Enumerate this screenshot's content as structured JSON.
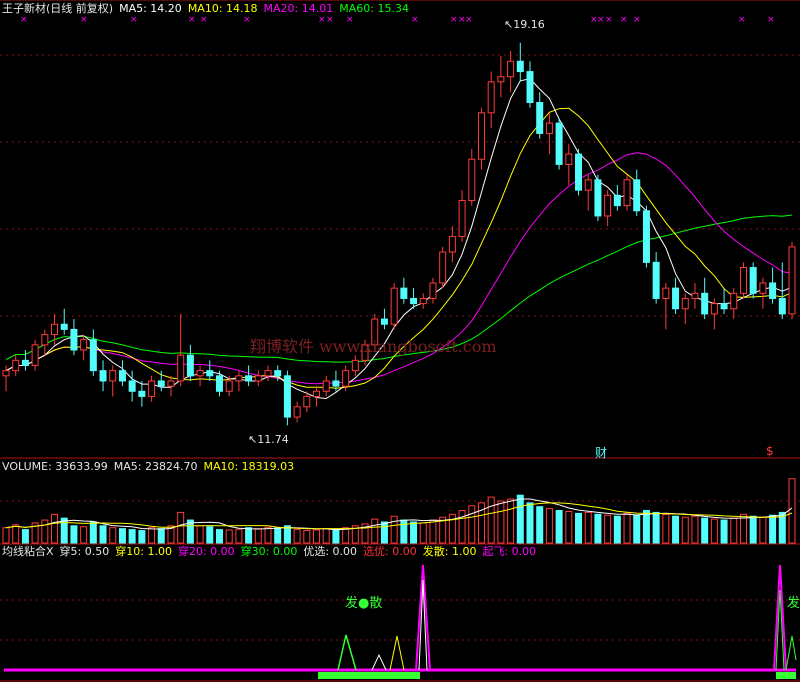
{
  "headers": {
    "main": [
      {
        "text": "王子新材(日线 前复权)",
        "color": "#e6e6e6"
      },
      {
        "text": "MA5: 14.20",
        "color": "#ffffff"
      },
      {
        "text": "MA10: 14.18",
        "color": "#ffff00"
      },
      {
        "text": "MA20: 14.01",
        "color": "#ff00ff"
      },
      {
        "text": "MA60: 15.34",
        "color": "#00ff00"
      }
    ],
    "volume": [
      {
        "text": "VOLUME: 33633.99",
        "color": "#e6e6e6"
      },
      {
        "text": "MA5: 23824.70",
        "color": "#e6e6e6"
      },
      {
        "text": "MA10: 18319.03",
        "color": "#ffff00"
      }
    ],
    "indicator": [
      {
        "text": "均线粘合X",
        "color": "#e6e6e6"
      },
      {
        "text": "穿5: 0.50",
        "color": "#e6e6e6"
      },
      {
        "text": "穿10: 1.00",
        "color": "#ffff00"
      },
      {
        "text": "穿20: 0.00",
        "color": "#ff00ff"
      },
      {
        "text": "穿30: 0.00",
        "color": "#00ff00"
      },
      {
        "text": "优选: 0.00",
        "color": "#e6e6e6"
      },
      {
        "text": "选优: 0.00",
        "color": "#ff3030"
      },
      {
        "text": "发散: 1.00",
        "color": "#ffff00"
      },
      {
        "text": "起飞: 0.00",
        "color": "#ff00ff"
      }
    ]
  },
  "watermark": "翔博软件 www.xiangbosoft.com",
  "annotations": {
    "high": "19.16",
    "low": "11.74",
    "fa_san": "发●散",
    "fa": "发",
    "cai": "财",
    "dollar": "$"
  },
  "colors": {
    "up": "#ff3a3a",
    "down": "#54fcfc",
    "ma5": "#ffffff",
    "ma10": "#ffff00",
    "ma20": "#ff00ff",
    "ma60": "#00ff00",
    "grid": "#8a1010"
  },
  "chart_data": [
    {
      "type": "candlestick",
      "series": [
        {
          "name": "MA5",
          "value": 14.2
        },
        {
          "name": "MA10",
          "value": 14.18
        },
        {
          "name": "MA20",
          "value": 14.01
        },
        {
          "name": "MA60",
          "value": 15.34
        }
      ],
      "ohlc": [
        [
          12.7,
          12.9,
          12.4,
          12.8
        ],
        [
          12.8,
          13.1,
          12.7,
          13.0
        ],
        [
          13.0,
          13.2,
          12.8,
          12.9
        ],
        [
          12.9,
          13.4,
          12.8,
          13.3
        ],
        [
          13.3,
          13.6,
          13.1,
          13.5
        ],
        [
          13.5,
          13.9,
          13.3,
          13.7
        ],
        [
          13.7,
          14.0,
          13.5,
          13.6
        ],
        [
          13.6,
          13.8,
          13.1,
          13.2
        ],
        [
          13.2,
          13.5,
          13.0,
          13.4
        ],
        [
          13.4,
          13.6,
          12.7,
          12.8
        ],
        [
          12.8,
          13.0,
          12.4,
          12.6
        ],
        [
          12.6,
          12.9,
          12.3,
          12.8
        ],
        [
          12.8,
          13.0,
          12.5,
          12.6
        ],
        [
          12.6,
          12.8,
          12.2,
          12.4
        ],
        [
          12.4,
          12.6,
          12.1,
          12.3
        ],
        [
          12.3,
          12.7,
          12.2,
          12.6
        ],
        [
          12.6,
          12.8,
          12.4,
          12.5
        ],
        [
          12.5,
          12.7,
          12.3,
          12.6
        ],
        [
          12.6,
          13.9,
          12.5,
          13.1
        ],
        [
          13.1,
          13.3,
          12.6,
          12.7
        ],
        [
          12.7,
          12.9,
          12.5,
          12.8
        ],
        [
          12.8,
          13.0,
          12.6,
          12.7
        ],
        [
          12.7,
          12.8,
          12.3,
          12.4
        ],
        [
          12.4,
          12.7,
          12.3,
          12.6
        ],
        [
          12.6,
          12.8,
          12.4,
          12.7
        ],
        [
          12.7,
          12.9,
          12.5,
          12.6
        ],
        [
          12.6,
          12.8,
          12.5,
          12.7
        ],
        [
          12.7,
          12.9,
          12.6,
          12.8
        ],
        [
          12.8,
          12.9,
          12.6,
          12.7
        ],
        [
          12.7,
          12.8,
          11.74,
          11.9
        ],
        [
          11.9,
          12.2,
          11.8,
          12.1
        ],
        [
          12.1,
          12.4,
          12.0,
          12.3
        ],
        [
          12.3,
          12.5,
          12.1,
          12.4
        ],
        [
          12.4,
          12.7,
          12.3,
          12.6
        ],
        [
          12.6,
          12.8,
          12.4,
          12.5
        ],
        [
          12.5,
          12.9,
          12.4,
          12.8
        ],
        [
          12.8,
          13.1,
          12.7,
          13.0
        ],
        [
          13.0,
          13.4,
          12.9,
          13.3
        ],
        [
          13.3,
          13.9,
          13.2,
          13.8
        ],
        [
          13.8,
          14.0,
          13.6,
          13.7
        ],
        [
          13.7,
          14.5,
          13.6,
          14.4
        ],
        [
          14.4,
          14.6,
          14.1,
          14.2
        ],
        [
          14.2,
          14.4,
          14.0,
          14.1
        ],
        [
          14.1,
          14.3,
          14.0,
          14.2
        ],
        [
          14.2,
          14.6,
          14.1,
          14.5
        ],
        [
          14.5,
          15.2,
          14.4,
          15.1
        ],
        [
          15.1,
          15.6,
          14.9,
          15.4
        ],
        [
          15.4,
          16.3,
          15.3,
          16.1
        ],
        [
          16.1,
          17.1,
          16.0,
          16.9
        ],
        [
          16.9,
          17.9,
          16.7,
          17.8
        ],
        [
          17.8,
          18.6,
          17.5,
          18.4
        ],
        [
          18.4,
          18.9,
          18.1,
          18.5
        ],
        [
          18.5,
          19.0,
          18.2,
          18.8
        ],
        [
          18.8,
          19.16,
          18.4,
          18.6
        ],
        [
          18.6,
          18.8,
          17.9,
          18.0
        ],
        [
          18.0,
          18.2,
          17.3,
          17.4
        ],
        [
          17.4,
          17.8,
          17.0,
          17.6
        ],
        [
          17.6,
          17.7,
          16.7,
          16.8
        ],
        [
          16.8,
          17.2,
          16.4,
          17.0
        ],
        [
          17.0,
          17.1,
          16.2,
          16.3
        ],
        [
          16.3,
          16.6,
          15.9,
          16.5
        ],
        [
          16.5,
          16.6,
          15.7,
          15.8
        ],
        [
          15.8,
          16.3,
          15.6,
          16.2
        ],
        [
          16.2,
          16.4,
          15.9,
          16.0
        ],
        [
          16.0,
          16.6,
          15.9,
          16.5
        ],
        [
          16.5,
          16.7,
          15.8,
          15.9
        ],
        [
          15.9,
          16.0,
          14.8,
          14.9
        ],
        [
          14.9,
          15.1,
          14.1,
          14.2
        ],
        [
          14.2,
          14.5,
          13.6,
          14.4
        ],
        [
          14.4,
          14.6,
          13.9,
          14.0
        ],
        [
          14.0,
          14.3,
          13.7,
          14.2
        ],
        [
          14.2,
          14.5,
          14.0,
          14.3
        ],
        [
          14.3,
          14.6,
          13.8,
          13.9
        ],
        [
          13.9,
          14.2,
          13.6,
          14.1
        ],
        [
          14.1,
          14.4,
          13.9,
          14.0
        ],
        [
          14.0,
          14.4,
          13.8,
          14.3
        ],
        [
          14.3,
          14.9,
          14.2,
          14.8
        ],
        [
          14.8,
          14.9,
          14.2,
          14.3
        ],
        [
          14.3,
          14.6,
          14.0,
          14.5
        ],
        [
          14.5,
          14.8,
          14.1,
          14.2
        ],
        [
          14.2,
          14.9,
          13.8,
          13.9
        ],
        [
          13.9,
          15.3,
          13.8,
          15.2
        ]
      ],
      "low_label": 11.74,
      "high_label": 19.16
    },
    {
      "type": "bar",
      "title": "VOLUME",
      "series": [
        {
          "name": "VOLUME",
          "value": 33633.99
        },
        {
          "name": "MA5",
          "value": 23824.7
        },
        {
          "name": "MA10",
          "value": 18319.03
        }
      ],
      "values": [
        8000,
        9500,
        7000,
        10500,
        12000,
        15000,
        13000,
        9000,
        8500,
        11000,
        9000,
        8000,
        7500,
        7000,
        6500,
        8000,
        7500,
        9000,
        16000,
        12000,
        9000,
        8500,
        7000,
        6800,
        7200,
        8000,
        7500,
        8200,
        7800,
        9000,
        7000,
        6500,
        6800,
        7500,
        7000,
        8000,
        9000,
        10000,
        12500,
        11000,
        14000,
        12000,
        11000,
        10500,
        12000,
        13500,
        15000,
        17000,
        19500,
        21000,
        24000,
        22000,
        23000,
        25000,
        21000,
        19000,
        18000,
        17000,
        16500,
        15500,
        16000,
        15000,
        14500,
        14000,
        15500,
        14500,
        17000,
        16000,
        15000,
        14000,
        13500,
        14000,
        13000,
        12500,
        12000,
        13000,
        15000,
        14000,
        13500,
        14500,
        16000,
        33633.99
      ]
    },
    {
      "type": "line",
      "title": "均线粘合X",
      "series": [
        {
          "name": "穿5",
          "value": 0.5
        },
        {
          "name": "穿10",
          "value": 1.0
        },
        {
          "name": "穿20",
          "value": 0.0
        },
        {
          "name": "穿30",
          "value": 0.0
        },
        {
          "name": "优选",
          "value": 0.0
        },
        {
          "name": "选优",
          "value": 0.0
        },
        {
          "name": "发散",
          "value": 1.0
        },
        {
          "name": "起飞",
          "value": 0.0
        }
      ]
    }
  ]
}
